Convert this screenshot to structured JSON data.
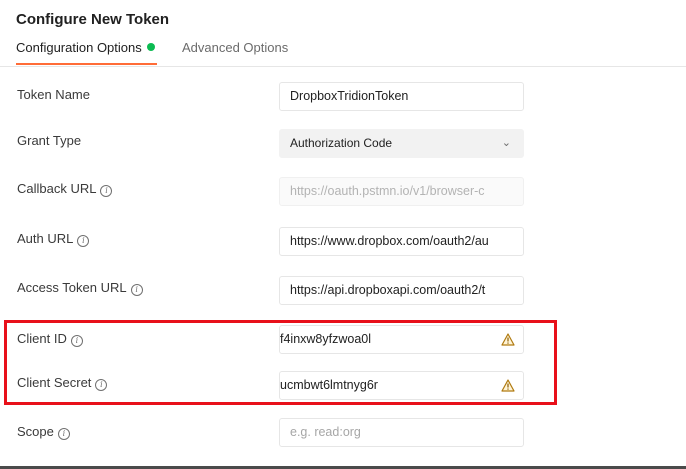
{
  "header": {
    "title": "Configure New Token"
  },
  "tabs": [
    {
      "label": "Configuration Options",
      "active": true
    },
    {
      "label": "Advanced Options",
      "active": false
    }
  ],
  "fields": {
    "token_name": {
      "label": "Token Name",
      "value": "DropboxTridionToken"
    },
    "grant_type": {
      "label": "Grant Type",
      "value": "Authorization Code"
    },
    "callback_url": {
      "label": "Callback URL",
      "value": "https://oauth.pstmn.io/v1/browser-c"
    },
    "auth_url": {
      "label": "Auth URL",
      "value": "https://www.dropbox.com/oauth2/au"
    },
    "access_token_url": {
      "label": "Access Token URL",
      "value": "https://api.dropboxapi.com/oauth2/t"
    },
    "client_id": {
      "label": "Client ID",
      "value": "f4inxw8yfzwoa0l"
    },
    "client_secret": {
      "label": "Client Secret",
      "value": "ucmbwt6lmtnyg6r"
    },
    "scope": {
      "label": "Scope",
      "placeholder": "e.g. read:org"
    }
  },
  "colors": {
    "accent": "#ff6c37",
    "status_dot": "#0cbb52",
    "highlight": "#e8101a",
    "warning": "#f5a623"
  }
}
